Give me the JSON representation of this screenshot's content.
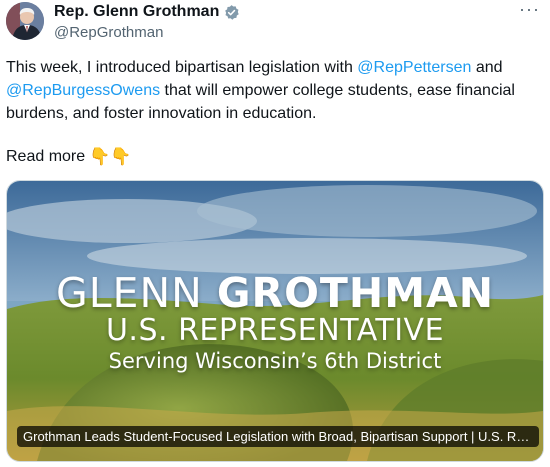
{
  "author": {
    "name": "Rep. Glenn Grothman",
    "handle": "@RepGrothman",
    "verified_badge": "verified-badge-icon"
  },
  "more_menu": "···",
  "post": {
    "text_1": "This week, I introduced bipartisan legislation with ",
    "mention_1": "@RepPettersen",
    "text_2": " and ",
    "mention_2": "@RepBurgessOwens",
    "text_3": " that will empower college students, ease financial burdens, and foster innovation in education.",
    "read_more": "Read more",
    "emojis": "👇👇"
  },
  "card": {
    "title_light": "GLENN ",
    "title_bold": "GROTHMAN",
    "subtitle": "U.S. REPRESENTATIVE",
    "tagline": "Serving Wisconsin’s 6th District",
    "caption": "Grothman Leads Student-Focused Legislation with Broad, Bipartisan Support | U.S. Rep..."
  },
  "colors": {
    "link": "#1d9bf0",
    "verified": "#829aab",
    "text": "#0f1419",
    "secondary": "#536471"
  }
}
